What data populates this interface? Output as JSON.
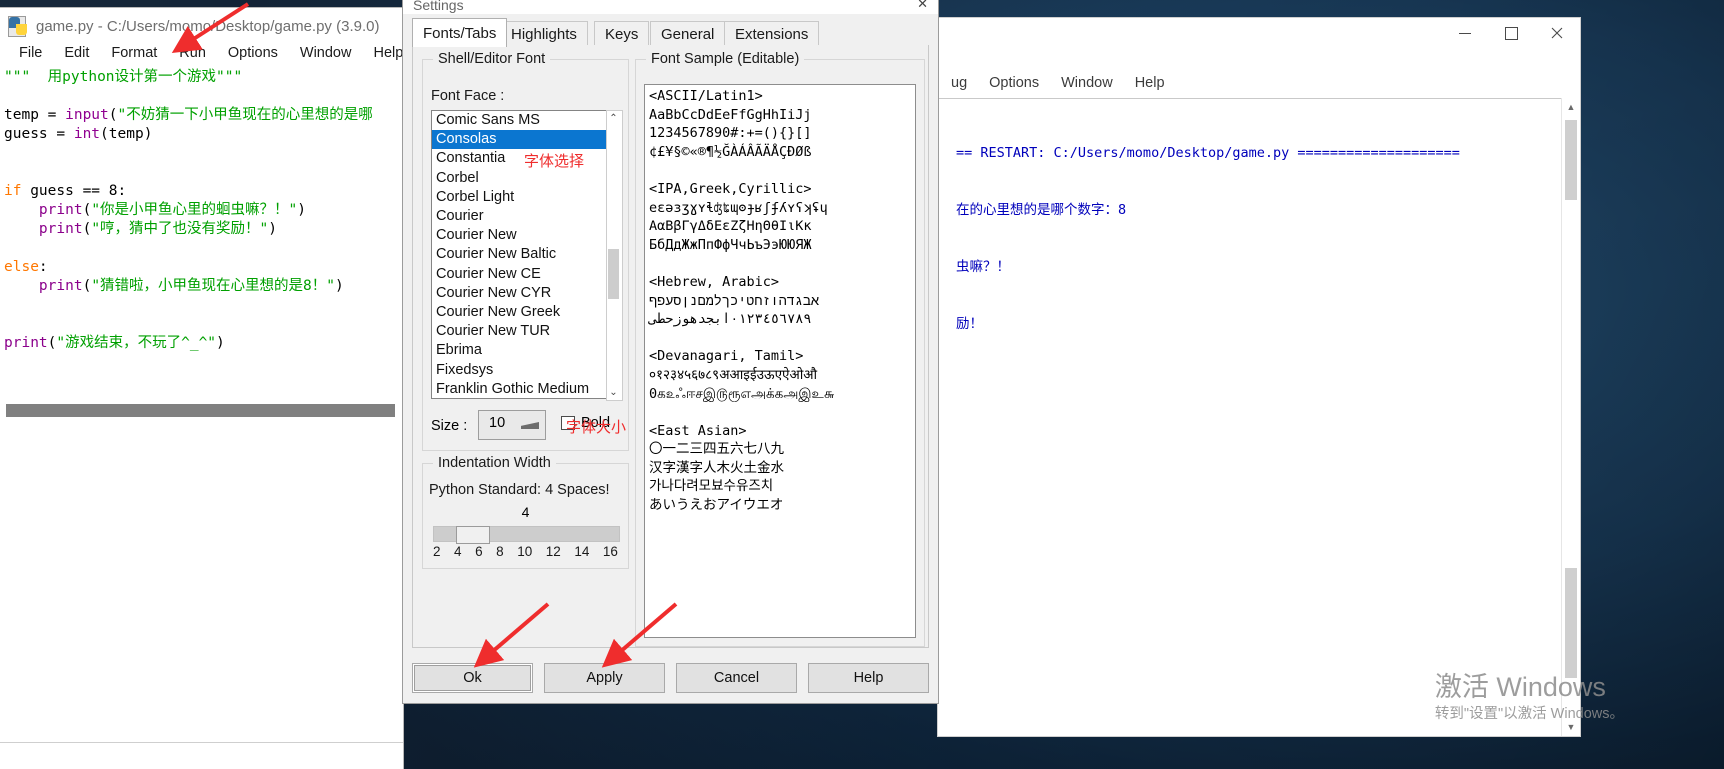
{
  "editor": {
    "title": "game.py - C:/Users/momo/Desktop/game.py (3.9.0)",
    "menu": [
      "File",
      "Edit",
      "Format",
      "Run",
      "Options",
      "Window",
      "Help"
    ],
    "code_lines": [
      [
        {
          "t": "\"\"\"  用python设计第一个游戏\"\"\"",
          "c": "k-str"
        }
      ],
      [],
      [
        {
          "t": "temp = ",
          "c": "k-plain"
        },
        {
          "t": "input",
          "c": "k-bi"
        },
        {
          "t": "(",
          "c": "k-plain"
        },
        {
          "t": "\"不妨猜一下小甲鱼现在的心里想的是哪",
          "c": "k-str"
        }
      ],
      [
        {
          "t": "guess = ",
          "c": "k-plain"
        },
        {
          "t": "int",
          "c": "k-bi"
        },
        {
          "t": "(temp)",
          "c": "k-plain"
        }
      ],
      [],
      [],
      [
        {
          "t": "if",
          "c": "k-kw"
        },
        {
          "t": " guess == ",
          "c": "k-plain"
        },
        {
          "t": "8",
          "c": "k-num"
        },
        {
          "t": ":",
          "c": "k-plain"
        }
      ],
      [
        {
          "t": "    ",
          "c": "k-plain"
        },
        {
          "t": "print",
          "c": "k-def"
        },
        {
          "t": "(",
          "c": "k-plain"
        },
        {
          "t": "\"你是小甲鱼心里的蛔虫嘛？！\"",
          "c": "k-str"
        },
        {
          "t": ")",
          "c": "k-plain"
        }
      ],
      [
        {
          "t": "    ",
          "c": "k-plain"
        },
        {
          "t": "print",
          "c": "k-def"
        },
        {
          "t": "(",
          "c": "k-plain"
        },
        {
          "t": "\"哼，猜中了也没有奖励！\"",
          "c": "k-str"
        },
        {
          "t": ")",
          "c": "k-plain"
        }
      ],
      [],
      [
        {
          "t": "else",
          "c": "k-kw"
        },
        {
          "t": ":",
          "c": "k-plain"
        }
      ],
      [
        {
          "t": "    ",
          "c": "k-plain"
        },
        {
          "t": "print",
          "c": "k-def"
        },
        {
          "t": "(",
          "c": "k-plain"
        },
        {
          "t": "\"猜错啦，小甲鱼现在心里想的是8！\"",
          "c": "k-str"
        },
        {
          "t": ")",
          "c": "k-plain"
        }
      ],
      [],
      [],
      [
        {
          "t": "print",
          "c": "k-def"
        },
        {
          "t": "(",
          "c": "k-plain"
        },
        {
          "t": "\"游戏结束，不玩了^_^\"",
          "c": "k-str"
        },
        {
          "t": ")",
          "c": "k-plain"
        }
      ]
    ]
  },
  "shell": {
    "menu": [
      "ug",
      "Options",
      "Window",
      "Help"
    ],
    "window_buttons": [
      "minimize",
      "maximize",
      "close"
    ],
    "output_lines": [
      "== RESTART: C:/Users/momo/Desktop/game.py ====================",
      "在的心里想的是哪个数字：8",
      "虫嘛？！",
      "励！"
    ]
  },
  "dialog": {
    "title": "Settings",
    "tabs": [
      "Fonts/Tabs",
      "Highlights",
      "Keys",
      "General",
      "Extensions"
    ],
    "active_tab": "Fonts/Tabs",
    "font_group_label": "Shell/Editor Font",
    "font_face_label": "Font Face :",
    "font_list": [
      "Comic Sans MS",
      "Consolas",
      "Constantia",
      "Corbel",
      "Corbel Light",
      "Courier",
      "Courier New",
      "Courier New Baltic",
      "Courier New CE",
      "Courier New CYR",
      "Courier New Greek",
      "Courier New TUR",
      "Ebrima",
      "Fixedsys",
      "Franklin Gothic Medium"
    ],
    "font_selected": "Consolas",
    "size_label": "Size :",
    "size_value": "10",
    "bold_label": "Bold",
    "bold_checked": false,
    "indent_group_label": "Indentation Width",
    "indent_hint": "Python Standard: 4 Spaces!",
    "indent_value": "4",
    "indent_ticks": [
      "2",
      "4",
      "6",
      "8",
      "10",
      "12",
      "14",
      "16"
    ],
    "sample_group_label": "Font Sample (Editable)",
    "sample_text": "<ASCII/Latin1>\nAaBbCcDdEeFfGgHhIiJj\n1234567890#:+=(){}[]\n¢£¥§©«®¶½ĞÀÁÂÃÄÅÇÐØß\n\n<IPA,Greek,Cyrillic>\neɛəɜʒɣʏɬʤʨɰʘɟʁʃʄʎʏʕʞʢɥ\nΑαΒβΓγΔδΕεΖζΗηΘθΙιΚκ\nБбДдЖжПпФфЧчЬъЭэЮЮЯЖ\n\n<Hebrew, Arabic>\nאבגדהוזחטיכךלמםנןסעפף\n٠١٢٣٤٥٦٧٨٩ابجدهوزحطى\n\n<Devanagari, Tamil>\n०१२३४५६७८९अआइईउऊएऐओऔ\n0க௨ஃஈசஇ௫ரூஎஅக்கஅஇஉ௬\n\n<East Asian>\n〇一二三四五六七八九\n汉字漢字人木火土金水\n가나다려모뵤수유즈치\nあいうえおアイウエオ",
    "buttons": [
      "Ok",
      "Apply",
      "Cancel",
      "Help"
    ],
    "focused_button": "Ok"
  },
  "annotations": [
    {
      "id": "font-select",
      "text": "字体选择"
    },
    {
      "id": "font-size",
      "text": "字体大小"
    }
  ],
  "watermark": {
    "title": "激活 Windows",
    "subtitle": "转到\"设置\"以激活 Windows。"
  },
  "colors": {
    "accent": "#0b76d0",
    "annotation": "#ef2d2d",
    "string": "#00A000",
    "keyword": "#FF7700",
    "definition": "#8B008B",
    "builtin": "#900090",
    "shell_out": "#0000BB"
  }
}
